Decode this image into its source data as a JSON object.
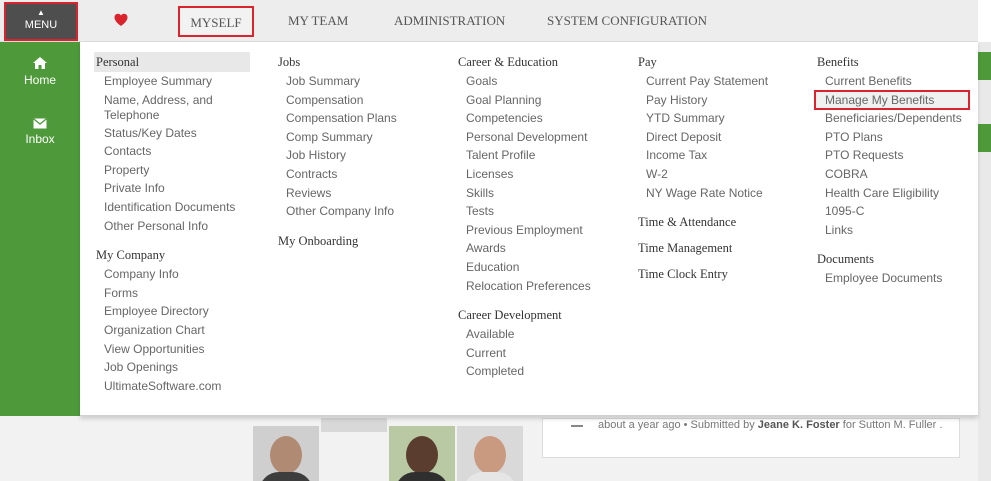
{
  "topbar": {
    "menu_label": "MENU",
    "favorites_icon": "heart-icon",
    "nav": [
      "MYSELF",
      "MY TEAM",
      "ADMINISTRATION",
      "SYSTEM CONFIGURATION"
    ],
    "active_nav": "MYSELF"
  },
  "sidebar": {
    "items": [
      {
        "label": "Home",
        "icon": "home-icon"
      },
      {
        "label": "Inbox",
        "icon": "envelope-icon"
      }
    ]
  },
  "colors": {
    "accent_green": "#4e9a3a",
    "highlight_red": "#d9232d",
    "heart_red": "#d9232d",
    "menu_button": "#4e4e4e"
  },
  "columns": [
    {
      "sections": [
        {
          "title": "Personal",
          "items": [
            "Employee Summary",
            "Name, Address, and Telephone",
            "Status/Key Dates",
            "Contacts",
            "Property",
            "Private Info",
            "Identification Documents",
            "Other Personal Info"
          ]
        },
        {
          "title": "My Company",
          "items": [
            "Company Info",
            "Forms",
            "Employee Directory",
            "Organization Chart",
            "View Opportunities",
            "Job Openings",
            "UltimateSoftware.com"
          ]
        }
      ]
    },
    {
      "sections": [
        {
          "title": "Jobs",
          "items": [
            "Job Summary",
            "Compensation",
            "Compensation Plans",
            "Comp Summary",
            "Job History",
            "Contracts",
            "Reviews",
            "Other Company Info"
          ]
        },
        {
          "title": "My Onboarding",
          "items": []
        }
      ]
    },
    {
      "sections": [
        {
          "title": "Career & Education",
          "items": [
            "Goals",
            "Goal Planning",
            "Competencies",
            "Personal Development",
            "Talent Profile",
            "Licenses",
            "Skills",
            "Tests",
            "Previous Employment",
            "Awards",
            "Education",
            "Relocation Preferences"
          ]
        },
        {
          "title": "Career Development",
          "items": [
            "Available",
            "Current",
            "Completed"
          ]
        }
      ]
    },
    {
      "sections": [
        {
          "title": "Pay",
          "items": [
            "Current Pay Statement",
            "Pay History",
            "YTD Summary",
            "Direct Deposit",
            "Income Tax",
            "W-2",
            "NY Wage Rate Notice"
          ]
        },
        {
          "title": "Time & Attendance",
          "items": []
        },
        {
          "title": "Time Management",
          "items": []
        },
        {
          "title": "Time Clock Entry",
          "items": []
        }
      ]
    },
    {
      "sections": [
        {
          "title": "Benefits",
          "items": [
            "Current Benefits",
            "Manage My Benefits",
            "Beneficiaries/Dependents",
            "PTO Plans",
            "PTO Requests",
            "COBRA",
            "Health Care Eligibility",
            "1095-C",
            "Links"
          ]
        },
        {
          "title": "Documents",
          "items": [
            "Employee Documents"
          ]
        }
      ]
    }
  ],
  "highlighted_item": "Manage My Benefits",
  "feed": {
    "text_before": "about a year ago • Submitted by ",
    "submitter": "Jeane K. Foster",
    "text_mid": " for Sutton M. Fuller ."
  }
}
